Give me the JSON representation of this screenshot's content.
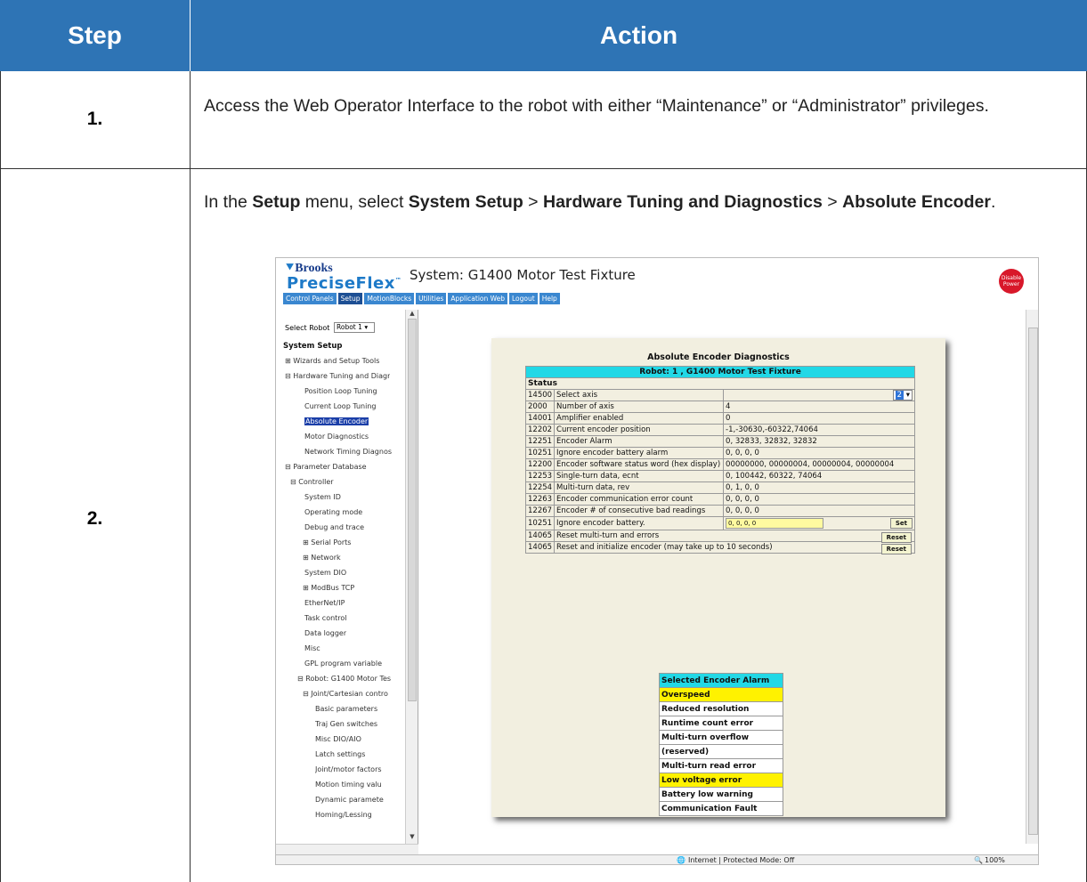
{
  "table": {
    "header_step": "Step",
    "header_action": "Action",
    "rows": [
      {
        "step": "1.",
        "text": "Access the Web Operator Interface to the robot with either “Maintenance” or “Administrator” privileges."
      },
      {
        "step": "2.",
        "text_parts": [
          "In the ",
          "Setup",
          " menu, select ",
          "System Setup",
          " > ",
          "Hardware Tuning and Diagnostics",
          " > ",
          "Absolute Encoder",
          "."
        ]
      }
    ]
  },
  "screenshot": {
    "brand_top": "Brooks",
    "brand_name": "PreciseFlex",
    "tm": "™",
    "system_title": "System: G1400 Motor Test Fixture",
    "disable_power": "Disable Power",
    "nav": [
      "Control Panels",
      "Setup",
      "MotionBlocks",
      "Utilities",
      "Application Web",
      "Logout",
      "Help"
    ],
    "nav_selected": "Setup",
    "select_robot_label": "Select Robot",
    "select_robot_value": "Robot 1",
    "tree": [
      {
        "text": "System Setup",
        "bold": true
      },
      {
        "text": "⊞ Wizards and Setup Tools"
      },
      {
        "text": "⊟ Hardware Tuning and Diagr"
      },
      {
        "text": "Position Loop Tuning"
      },
      {
        "text": "Current Loop Tuning"
      },
      {
        "text": "Absolute Encoder",
        "selected": true
      },
      {
        "text": "Motor Diagnostics"
      },
      {
        "text": "Network Timing Diagnos"
      },
      {
        "text": "⊟ Parameter Database"
      },
      {
        "text": "⊟ Controller"
      },
      {
        "text": "System ID"
      },
      {
        "text": "Operating mode"
      },
      {
        "text": "Debug and trace"
      },
      {
        "text": "⊞ Serial Ports"
      },
      {
        "text": "⊞ Network"
      },
      {
        "text": "System DIO"
      },
      {
        "text": "⊞ ModBus TCP"
      },
      {
        "text": "EtherNet/IP"
      },
      {
        "text": "Task control"
      },
      {
        "text": "Data logger"
      },
      {
        "text": "Misc"
      },
      {
        "text": "GPL program variable"
      },
      {
        "text": "⊟ Robot: G1400 Motor Tes"
      },
      {
        "text": "⊟ Joint/Cartesian contro"
      },
      {
        "text": "Basic parameters"
      },
      {
        "text": "Traj Gen switches"
      },
      {
        "text": "Misc DIO/AIO"
      },
      {
        "text": "Latch settings"
      },
      {
        "text": "Joint/motor factors"
      },
      {
        "text": "Motion timing valu"
      },
      {
        "text": "Dynamic paramete"
      },
      {
        "text": "Homing/Lessing"
      }
    ],
    "panel_title": "Absolute Encoder Diagnostics",
    "robot_row": "Robot: 1 , G1400 Motor Test Fixture",
    "status_label": "Status",
    "rows": [
      {
        "id": "14500",
        "label": "Select axis",
        "value": "",
        "select": "2"
      },
      {
        "id": "2000",
        "label": "Number of axis",
        "value": "4"
      },
      {
        "id": "14001",
        "label": "Amplifier enabled",
        "value": "0"
      },
      {
        "id": "12202",
        "label": "Current encoder position",
        "value": "-1,-30630,-60322,74064"
      },
      {
        "id": "12251",
        "label": "Encoder Alarm",
        "value": "0, 32833, 32832, 32832"
      },
      {
        "id": "10251",
        "label": "Ignore encoder battery alarm",
        "value": "0, 0, 0, 0"
      },
      {
        "id": "12200",
        "label": "Encoder software status word (hex display)",
        "value": "00000000, 00000004, 00000004, 00000004"
      },
      {
        "id": "12253",
        "label": "Single-turn data, ecnt",
        "value": "0, 100442, 60322, 74064"
      },
      {
        "id": "12254",
        "label": "Multi-turn data, rev",
        "value": "0, 1, 0, 0"
      },
      {
        "id": "12263",
        "label": "Encoder communication error count",
        "value": "0, 0, 0, 0"
      },
      {
        "id": "12267",
        "label": "Encoder # of consecutive bad readings",
        "value": "0, 0, 0, 0"
      },
      {
        "id": "10251",
        "label": "Ignore encoder battery.",
        "input": "0, 0, 0, 0",
        "button": "Set"
      },
      {
        "id": "14065",
        "label": "Reset multi-turn and errors",
        "button": "Reset"
      },
      {
        "id": "14065",
        "label": "Reset and initialize encoder (may take up to 10 seconds)",
        "button": "Reset"
      }
    ],
    "alarm_header": "Selected Encoder Alarm",
    "alarms": [
      {
        "text": "Overspeed",
        "active": true
      },
      {
        "text": "Reduced resolution",
        "active": false
      },
      {
        "text": "Runtime count error",
        "active": false
      },
      {
        "text": "Multi-turn overflow",
        "active": false
      },
      {
        "text": "(reserved)",
        "active": false
      },
      {
        "text": "Multi-turn read error",
        "active": false
      },
      {
        "text": "Low voltage error",
        "active": true
      },
      {
        "text": "Battery low warning",
        "active": false
      },
      {
        "text": "Communication Fault",
        "active": false
      }
    ],
    "statusbar": "Internet | Protected Mode: Off",
    "zoom": "100%"
  }
}
